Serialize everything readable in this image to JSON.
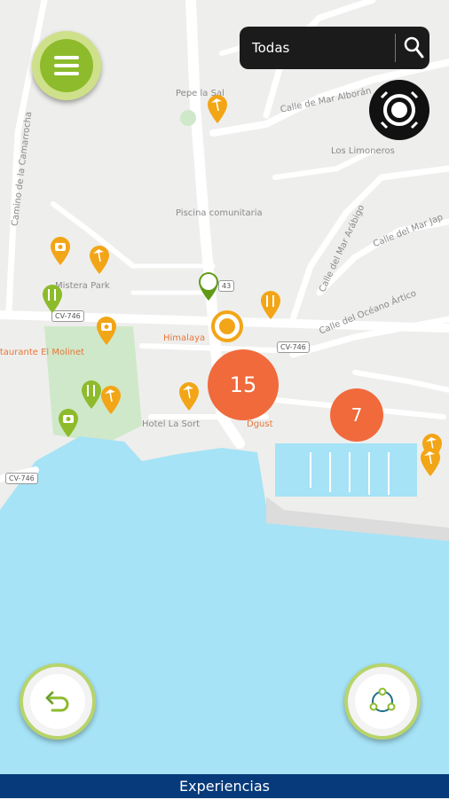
{
  "search": {
    "value": "Todas"
  },
  "map": {
    "streets": {
      "camarrocha": "Camino de la Camarrocha",
      "mar_alboran": "Calle de Mar Alborán",
      "mar_arabigo": "Calle del Mar Arábigo",
      "mar_japon": "Calle del Mar Jap",
      "oceano_artico": "Calle del Océano Ártico"
    },
    "places": {
      "pepe_la_sal": "Pepe la Sal",
      "los_limoneros": "Los Limoneros",
      "piscina": "Piscina comunitaria",
      "mistera_park": "Mistera Park",
      "himalaya": "Himalaya",
      "restaurante": "Restaurante El Molinet",
      "hotel": "Hotel La Sort",
      "dgust": "Dgust"
    },
    "roads": {
      "cv746_a": "CV-746",
      "cv746_b": "CV-746",
      "cv746_c": "CV-746",
      "n43": "43"
    },
    "clusters": {
      "large": "15",
      "small": "7"
    }
  },
  "bottom_bar": {
    "label": "Experiencias"
  },
  "colors": {
    "accent_green": "#8dbb2b",
    "orange_pin": "#f2a516",
    "cluster": "#f06a3c",
    "sea": "#9fe1f5",
    "nav": "#063a7a"
  }
}
